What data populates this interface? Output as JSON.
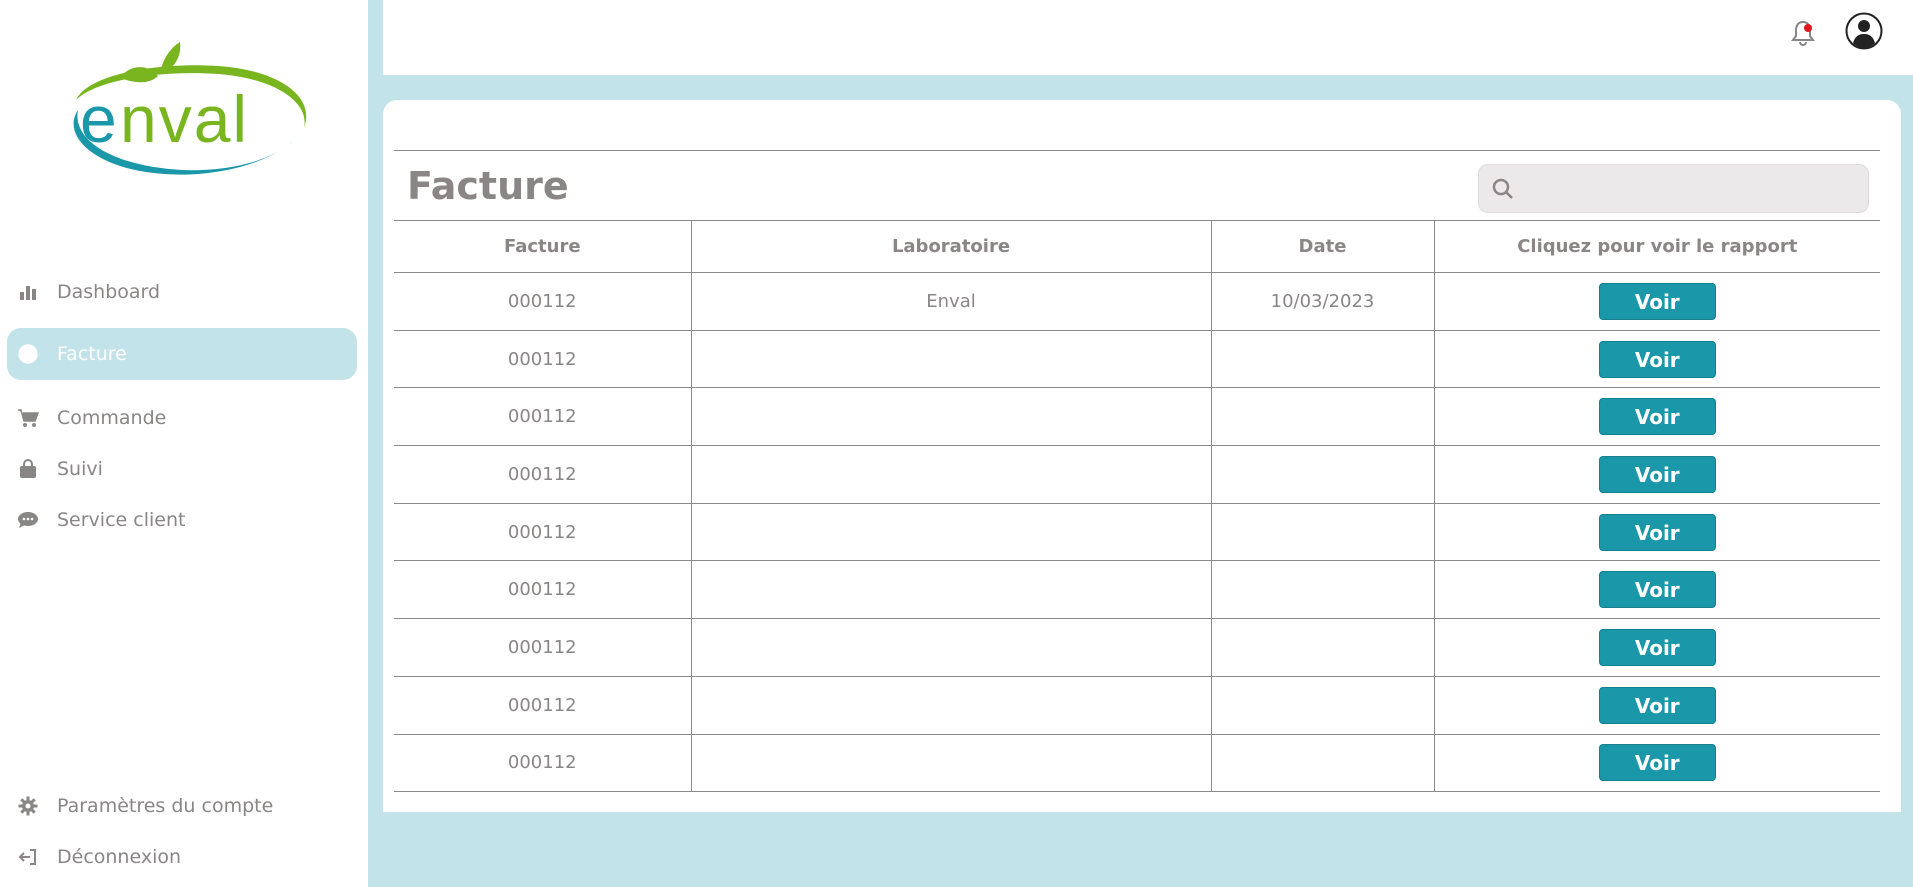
{
  "brand": {
    "name": "enval",
    "green": "#79b51e",
    "teal": "#1a97a8"
  },
  "colors": {
    "accent": "#1a97a8",
    "background": "#c2e3ea",
    "text": "#8a8686",
    "notification_dot": "#e0171f"
  },
  "sidebar": {
    "items": [
      {
        "label": "Dashboard",
        "icon": "bar-chart-icon",
        "active": false
      },
      {
        "label": "Facture",
        "icon": "peace-icon",
        "active": true
      },
      {
        "label": "Commande",
        "icon": "cart-icon",
        "active": false
      },
      {
        "label": "Suivi",
        "icon": "bag-icon",
        "active": false
      },
      {
        "label": "Service client",
        "icon": "chat-icon",
        "active": false
      }
    ],
    "bottom_items": [
      {
        "label": "Paramètres du compte",
        "icon": "gear-icon"
      },
      {
        "label": "Déconnexion",
        "icon": "logout-icon"
      }
    ]
  },
  "topbar": {
    "bell_icon": "bell-icon",
    "has_notification": true,
    "avatar_icon": "user-avatar-icon"
  },
  "main": {
    "title": "Facture",
    "search": {
      "placeholder": "",
      "value": ""
    },
    "table": {
      "headers": [
        "Facture",
        "Laboratoire",
        "Date",
        "Cliquez pour voir le rapport"
      ],
      "button_label": "Voir",
      "rows": [
        {
          "facture": "000112",
          "laboratoire": "Enval",
          "date": "10/03/2023"
        },
        {
          "facture": "000112",
          "laboratoire": "",
          "date": ""
        },
        {
          "facture": "000112",
          "laboratoire": "",
          "date": ""
        },
        {
          "facture": "000112",
          "laboratoire": "",
          "date": ""
        },
        {
          "facture": "000112",
          "laboratoire": "",
          "date": ""
        },
        {
          "facture": "000112",
          "laboratoire": "",
          "date": ""
        },
        {
          "facture": "000112",
          "laboratoire": "",
          "date": ""
        },
        {
          "facture": "000112",
          "laboratoire": "",
          "date": ""
        },
        {
          "facture": "000112",
          "laboratoire": "",
          "date": ""
        }
      ]
    }
  }
}
